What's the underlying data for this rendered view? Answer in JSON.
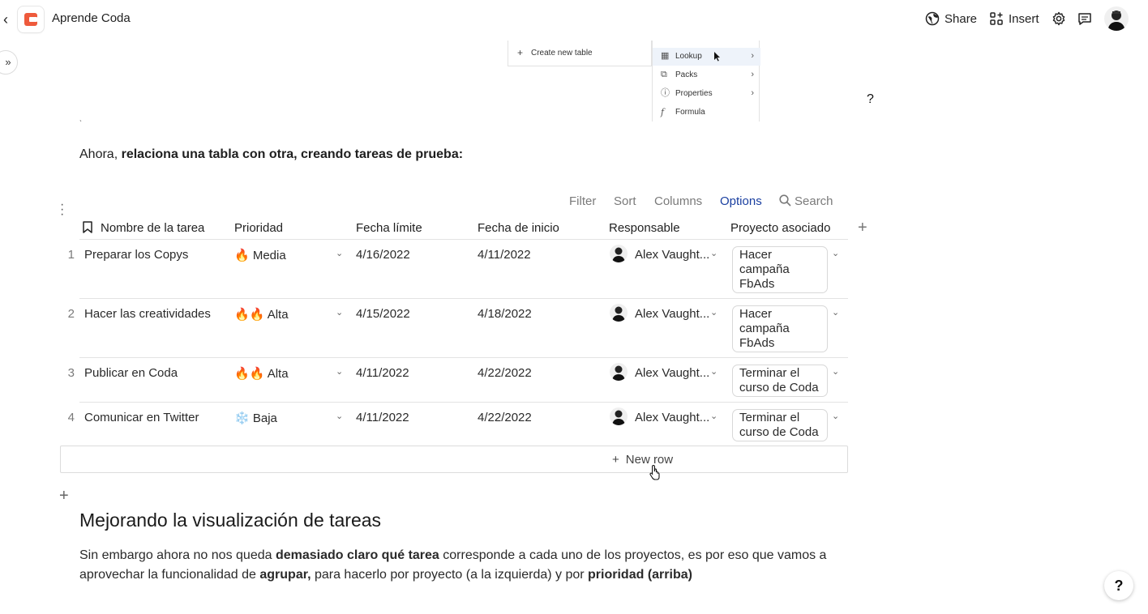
{
  "header": {
    "doc_title": "Aprende Coda",
    "share_label": "Share",
    "insert_label": "Insert",
    "brand_color": "#ee5a3c"
  },
  "embed": {
    "create_table_label": "Create new table",
    "menu_items": [
      {
        "label": "Lookup",
        "icon": "table-icon"
      },
      {
        "label": "Packs",
        "icon": "puzzle-icon"
      },
      {
        "label": "Properties",
        "icon": "info-icon"
      },
      {
        "label": "Formula",
        "icon": "formula-icon"
      }
    ]
  },
  "help_inline": "?",
  "intro": {
    "prefix": "Ahora, ",
    "bold": "relaciona una tabla con otra, creando tareas de prueba:"
  },
  "toolbar": {
    "filter": "Filter",
    "sort": "Sort",
    "columns": "Columns",
    "options": "Options",
    "search": "Search",
    "active_color": "#1a3fa0"
  },
  "table": {
    "columns": [
      "Nombre de la tarea",
      "Prioridad",
      "Fecha límite",
      "Fecha de inicio",
      "Responsable",
      "Proyecto asociado"
    ],
    "rows": [
      {
        "num": "1",
        "name": "Preparar los Copys",
        "priority": "🔥 Media",
        "deadline": "4/16/2022",
        "start": "4/11/2022",
        "owner": "Alex Vaught...",
        "project": "Hacer campaña FbAds"
      },
      {
        "num": "2",
        "name": "Hacer las creatividades",
        "priority": "🔥🔥 Alta",
        "deadline": "4/15/2022",
        "start": "4/18/2022",
        "owner": "Alex Vaught...",
        "project": "Hacer campaña FbAds"
      },
      {
        "num": "3",
        "name": "Publicar en Coda",
        "priority": "🔥🔥 Alta",
        "deadline": "4/11/2022",
        "start": "4/22/2022",
        "owner": "Alex Vaught...",
        "project": "Terminar el curso de Coda"
      },
      {
        "num": "4",
        "name": "Comunicar en Twitter",
        "priority": "❄️ Baja",
        "deadline": "4/11/2022",
        "start": "4/22/2022",
        "owner": "Alex Vaught...",
        "project": "Terminar el curso de Coda"
      }
    ],
    "new_row_label": "New row"
  },
  "section": {
    "heading": "Mejorando la visualización de tareas",
    "p1": "Sin embargo ahora no nos queda ",
    "b1": "demasiado claro qué tarea",
    "p2": " corresponde a cada uno de los proyectos, es por eso que vamos a aprovechar la funcionalidad de ",
    "b2": "agrupar,",
    "p3": " para hacerlo por proyecto (a la izquierda) y por ",
    "b3": "prioridad (arriba)"
  },
  "help_button": "?"
}
